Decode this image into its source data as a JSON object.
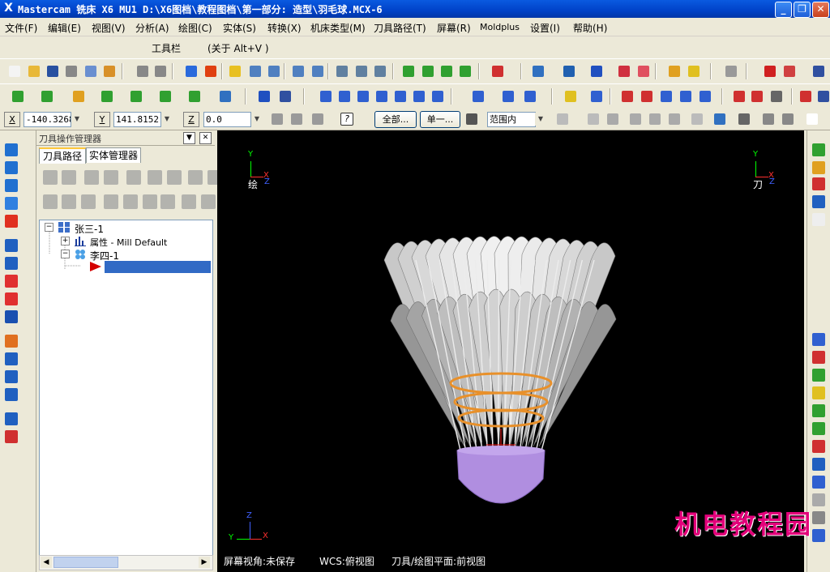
{
  "window": {
    "title": "Mastercam 铣床 X6 MU1  D:\\X6图档\\教程图档\\第一部分: 造型\\羽毛球.MCX-6",
    "app_icon": "X",
    "controls": [
      "_",
      "❐",
      "✕"
    ]
  },
  "menu": [
    "文件(F)",
    "编辑(E)",
    "视图(V)",
    "分析(A)",
    "绘图(C)",
    "实体(S)",
    "转换(X)",
    "机床类型(M)",
    "刀具路径(T)",
    "屏幕(R)",
    "Moldplus",
    "设置(I)",
    "帮助(H)"
  ],
  "toolbar_title": {
    "label": "工具栏",
    "about": "(关于 Alt+V )"
  },
  "coords": {
    "x_label": "X",
    "x_value": "-140.3268",
    "y_label": "Y",
    "y_value": "141.8152",
    "z_label": "Z",
    "z_value": "0.0"
  },
  "select_bar": {
    "all_button": "全部...",
    "single_button": "单一...",
    "range_select": "范围内"
  },
  "manager": {
    "header": "刀具操作管理器",
    "tabs": [
      "刀具路径",
      "实体管理器"
    ],
    "tree": {
      "machine_group": "张三-1",
      "properties": "属性 - Mill Default",
      "toolpath_group": "李四-1"
    }
  },
  "viewport": {
    "gview_label_left": "绘",
    "gview_label_right": "刀",
    "axis_y": "Y",
    "axis_x": "X",
    "axis_z": "Z",
    "status_screen_view": "屏幕视角:未保存",
    "status_wcs": "WCS:俯视图",
    "status_tplane": "刀具/绘图平面:前视图"
  },
  "watermark": "机电教程园",
  "colors": {
    "titlebar": "#0a5ae0",
    "viewport_bg": "#000000",
    "shuttlecock_cork": "#b08ee0",
    "shuttlecock_rings": "#e8902a",
    "feathers": "#d8d8d8",
    "selected_row": "#316ac5",
    "watermark": "#e3007a"
  }
}
